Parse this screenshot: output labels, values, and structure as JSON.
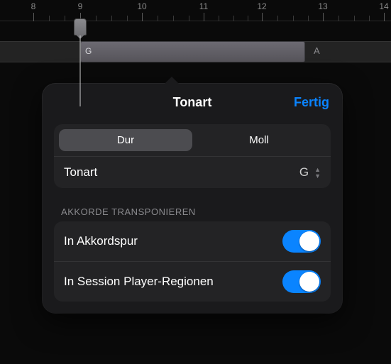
{
  "ruler": {
    "numbers": [
      "8",
      "9",
      "10",
      "11",
      "12",
      "13",
      "14"
    ]
  },
  "track": {
    "region_label": "G",
    "next_label": "A"
  },
  "popover": {
    "title": "Tonart",
    "done": "Fertig",
    "segmented": {
      "major": "Dur",
      "minor": "Moll",
      "selected": "major"
    },
    "key_row": {
      "label": "Tonart",
      "value": "G"
    },
    "transpose": {
      "header": "AKKORDE TRANSPONIEREN",
      "rows": [
        {
          "label": "In Akkordspur",
          "on": true
        },
        {
          "label": "In Session Player-Regionen",
          "on": true
        }
      ]
    }
  }
}
